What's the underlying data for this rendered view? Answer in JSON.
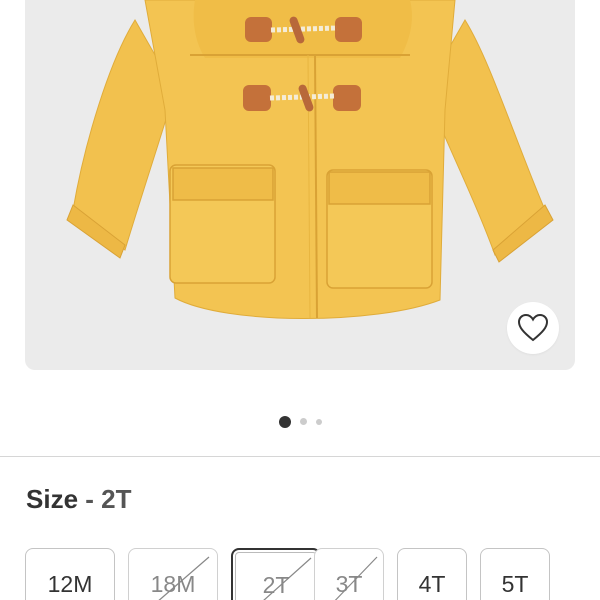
{
  "product": {
    "image_alt": "Yellow toddler duffle coat with hood and toggle closures",
    "favorite_icon": "heart-outline-icon"
  },
  "carousel": {
    "count": 3,
    "active_index": 0
  },
  "size_selector": {
    "label": "Size",
    "separator": "-",
    "selected_value": "2T",
    "options": [
      {
        "label": "12M",
        "available": true,
        "selected": false
      },
      {
        "label": "18M",
        "available": false,
        "selected": false
      },
      {
        "label": "2T",
        "available": false,
        "selected": true
      },
      {
        "label": "3T",
        "available": false,
        "selected": false
      },
      {
        "label": "4T",
        "available": true,
        "selected": false
      },
      {
        "label": "5T",
        "available": true,
        "selected": false
      }
    ]
  },
  "colors": {
    "coat": "#f2c14e",
    "coat_shade": "#e3ad38",
    "background": "#ebebeb",
    "toggle_leather": "#c4713a",
    "accent_text": "#333333"
  }
}
